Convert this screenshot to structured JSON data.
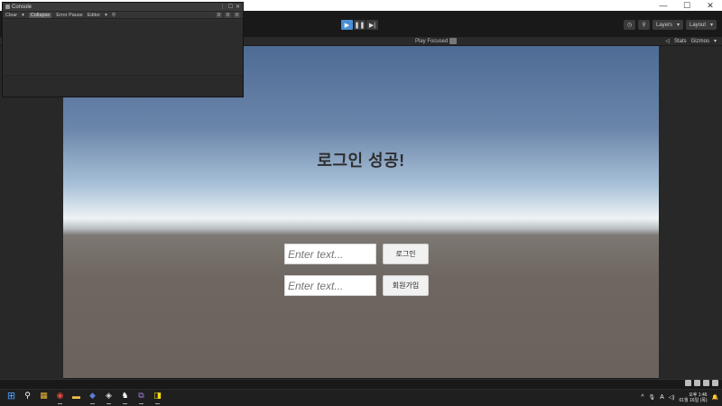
{
  "window": {
    "controls": [
      "—",
      "☐",
      "✕"
    ]
  },
  "toolbar": {
    "play_icons": [
      "▶",
      "❚❚",
      "▶|"
    ],
    "history_icon": "◷",
    "search_icon": "⚲",
    "layers_label": "Layers",
    "layout_label": "Layout",
    "dropdown_glyph": "▾"
  },
  "game_view": {
    "play_mode": "Play Focused",
    "dropdown_glyph": "▾",
    "stats_label": "Stats",
    "gizmos_label": "Gizmos"
  },
  "console": {
    "title": "Console",
    "title_ctrls": [
      "⋮",
      "☐",
      "✕"
    ],
    "clear_label": "Clear",
    "clear_dropdown": "▾",
    "collapse_label": "Collapse",
    "error_pause_label": "Error Pause",
    "editor_label": "Editor",
    "editor_dropdown": "▾",
    "counts": [
      "0",
      "0",
      "0"
    ]
  },
  "game": {
    "title": "로그인 성공!",
    "input1_placeholder": "Enter text...",
    "input2_placeholder": "Enter text...",
    "login_button": "로그인",
    "signup_button": "회원가입"
  },
  "taskbar": {
    "start_glyph": "⊞",
    "search_glyph": "⚲",
    "apps": [
      "▦",
      "◉",
      "▬",
      "◆",
      "◈",
      "♞",
      "⧉",
      "◨"
    ],
    "tray_chevron": "^",
    "tray_mic": "🎙",
    "tray_lang": "A",
    "tray_volume": "◁)",
    "time": "오후 1:46",
    "date": "01월 16일 (목)",
    "bell": "🔔"
  },
  "colors": {
    "accent": "#4a8fd6",
    "editor_bg": "#191919",
    "panel_bg": "#282828",
    "sky_top": "#4e6b95",
    "horizon": "#eef3f4",
    "ground": "#6a625c"
  }
}
